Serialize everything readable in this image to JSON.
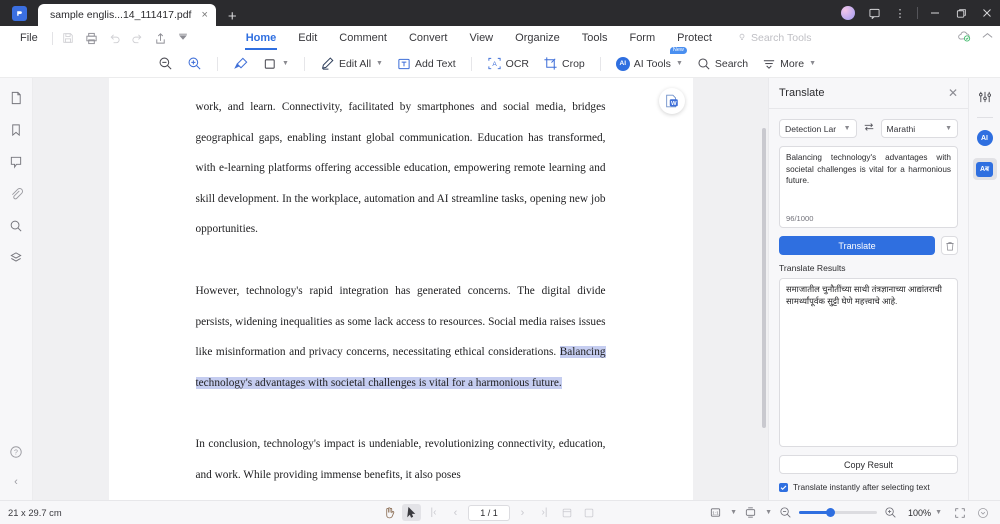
{
  "titlebar": {
    "tab_label": "sample englis...14_111417.pdf",
    "tab_close": "×",
    "new_tab": "+",
    "minimize": "—",
    "maximize": "❐",
    "close": "✕",
    "more": "⋮"
  },
  "menu": {
    "file_label": "File",
    "tabs": [
      {
        "label": "Home",
        "active": true
      },
      {
        "label": "Edit",
        "active": false
      },
      {
        "label": "Comment",
        "active": false
      },
      {
        "label": "Convert",
        "active": false
      },
      {
        "label": "View",
        "active": false
      },
      {
        "label": "Organize",
        "active": false
      },
      {
        "label": "Tools",
        "active": false
      },
      {
        "label": "Form",
        "active": false
      },
      {
        "label": "Protect",
        "active": false
      }
    ],
    "search_tools": "Search Tools",
    "quick_icons": [
      "save-icon",
      "print-icon",
      "undo-icon",
      "redo-icon",
      "share-icon",
      "more-down-icon"
    ]
  },
  "toolbar": {
    "zoom_out": "zoom-out-icon",
    "zoom_in": "zoom-in-icon",
    "highlight": "highlight-icon",
    "shape": "shape-icon",
    "edit_all": "Edit All",
    "add_text": "Add Text",
    "ocr": "OCR",
    "crop": "Crop",
    "ai_tools": "AI Tools",
    "ai_badge": "New",
    "search": "Search",
    "more": "More"
  },
  "left_rail": {
    "items": [
      {
        "name": "thumbnails-icon"
      },
      {
        "name": "bookmark-icon"
      },
      {
        "name": "comment-icon"
      },
      {
        "name": "attachment-icon"
      },
      {
        "name": "search-icon"
      },
      {
        "name": "layers-icon"
      }
    ],
    "help": "?",
    "collapse": "‹"
  },
  "document": {
    "paragraph1": "work, and learn. Connectivity, facilitated by smartphones and social media, bridges geographical gaps, enabling instant global communication. Education has transformed, with e-learning platforms offering accessible education, empowering remote learning and skill development. In the workplace, automation and AI streamline tasks, opening new job opportunities.",
    "paragraph2_pre": "However, technology's rapid integration has generated concerns. The digital divide persists, widening inequalities as some lack access to resources. Social media raises issues like misinformation and privacy concerns, necessitating ethical considerations. ",
    "paragraph2_highlight": "Balancing technology's advantages with societal challenges is vital for a harmonious future.",
    "paragraph3": "In conclusion, technology's impact is undeniable, revolutionizing connectivity, education, and work. While providing immense benefits, it also poses",
    "convert_float": "convert-to-word-icon",
    "highlight_color": "#c5cdf0"
  },
  "panel": {
    "title": "Translate",
    "close": "✕",
    "source_lang": "Detection Lar",
    "target_lang": "Marathi",
    "swap_icon": "swap-icon",
    "source_text": "Balancing technology's advantages with societal challenges is vital for a harmonious future.",
    "counter": "96/1000",
    "translate_button": "Translate",
    "delete_icon": "trash-icon",
    "results_label": "Translate Results",
    "result_text": "समाजातील चुनौतींच्या साथी तंत्रज्ञानाच्या आद्यांतराची सामर्थ्यांपूर्वक सुट्टी घेणे महत्त्वाचे आहे.",
    "copy_button": "Copy Result",
    "checkbox_label": "Translate instantly after selecting text",
    "checkbox_checked": true,
    "accent_color": "#2f6fe0"
  },
  "right_rail": {
    "items": [
      {
        "name": "settings-sliders-icon",
        "selected": false
      },
      {
        "name": "ai-assistant-icon",
        "selected": false
      },
      {
        "name": "translate-icon",
        "selected": true
      }
    ]
  },
  "statusbar": {
    "dimensions": "21 x 29.7 cm",
    "hand_tool": "hand-tool-icon",
    "select_tool": "select-tool-icon",
    "first_page": "|‹",
    "prev_page": "‹",
    "page_value": "1 / 1",
    "next_page": "›",
    "last_page": "›|",
    "fit_page": "fit-page-icon",
    "single_page": "single-page-icon",
    "view_mode": "page-layout-icon",
    "scroll_mode": "scroll-mode-icon",
    "zoom_out": "zoom-out-icon",
    "zoom_in": "zoom-in-icon",
    "zoom_value": "100%",
    "fullscreen": "fullscreen-icon",
    "expand": "expand-icon"
  }
}
